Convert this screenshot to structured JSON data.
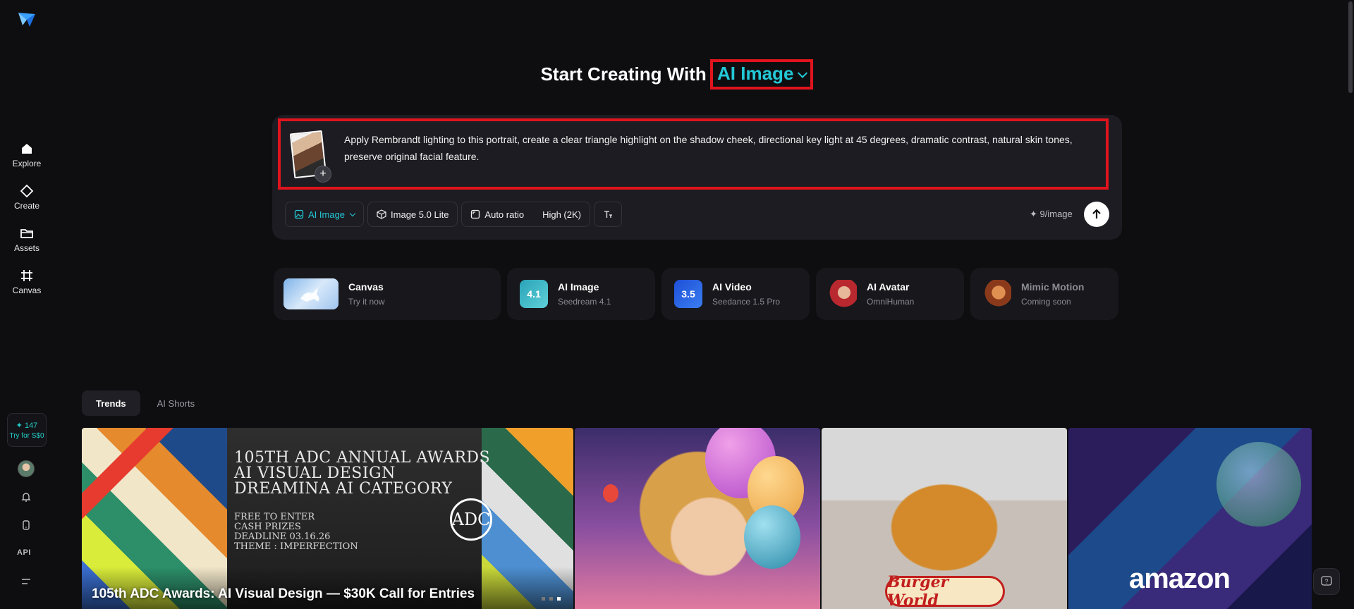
{
  "sidebar": {
    "nav": [
      {
        "label": "Explore",
        "icon": "home-icon"
      },
      {
        "label": "Create",
        "icon": "diamond-icon"
      },
      {
        "label": "Assets",
        "icon": "folder-icon"
      },
      {
        "label": "Canvas",
        "icon": "frame-icon"
      }
    ],
    "credits_count": "✦ 147",
    "credits_cta": "Try for S$0",
    "api_label": "API"
  },
  "headline": {
    "prefix": "Start Creating With",
    "mode": "AI Image"
  },
  "composer": {
    "prompt": "Apply Rembrandt lighting to this portrait, create a clear triangle highlight on the shadow cheek, directional key light at 45 degrees, dramatic contrast, natural skin tones, preserve original facial feature.",
    "add_symbol": "+",
    "mode_label": "AI Image",
    "model_label": "Image 5.0 Lite",
    "ratio_label": "Auto ratio",
    "quality_label": "High (2K)",
    "cost": "✦ 9/image"
  },
  "cards": [
    {
      "title": "Canvas",
      "subtitle": "Try it now"
    },
    {
      "title": "AI Image",
      "subtitle": "Seedream 4.1",
      "badge": "4.1"
    },
    {
      "title": "AI Video",
      "subtitle": "Seedance 1.5 Pro",
      "badge": "3.5"
    },
    {
      "title": "AI Avatar",
      "subtitle": "OmniHuman"
    },
    {
      "title": "Mimic Motion",
      "subtitle": "Coming soon"
    }
  ],
  "tabs": [
    {
      "label": "Trends",
      "active": true
    },
    {
      "label": "AI Shorts",
      "active": false
    }
  ],
  "gallery": {
    "tile1": {
      "poster_lines": [
        "105TH ADC ANNUAL AWARDS",
        "AI VISUAL DESIGN",
        "DREAMINA AI CATEGORY"
      ],
      "poster_small_lines": [
        "FREE TO ENTER",
        "CASH PRIZES",
        "DEADLINE 03.16.26",
        "THEME : IMPERFECTION"
      ],
      "caption": "105th ADC Awards: AI Visual Design — $30K Call for Entries"
    },
    "tile3": {
      "label": "Burger World"
    },
    "tile4": {
      "label": "amazon"
    }
  },
  "colors": {
    "accent": "#23c8d6",
    "highlight_border": "#e0141c",
    "background": "#0e0e11"
  }
}
